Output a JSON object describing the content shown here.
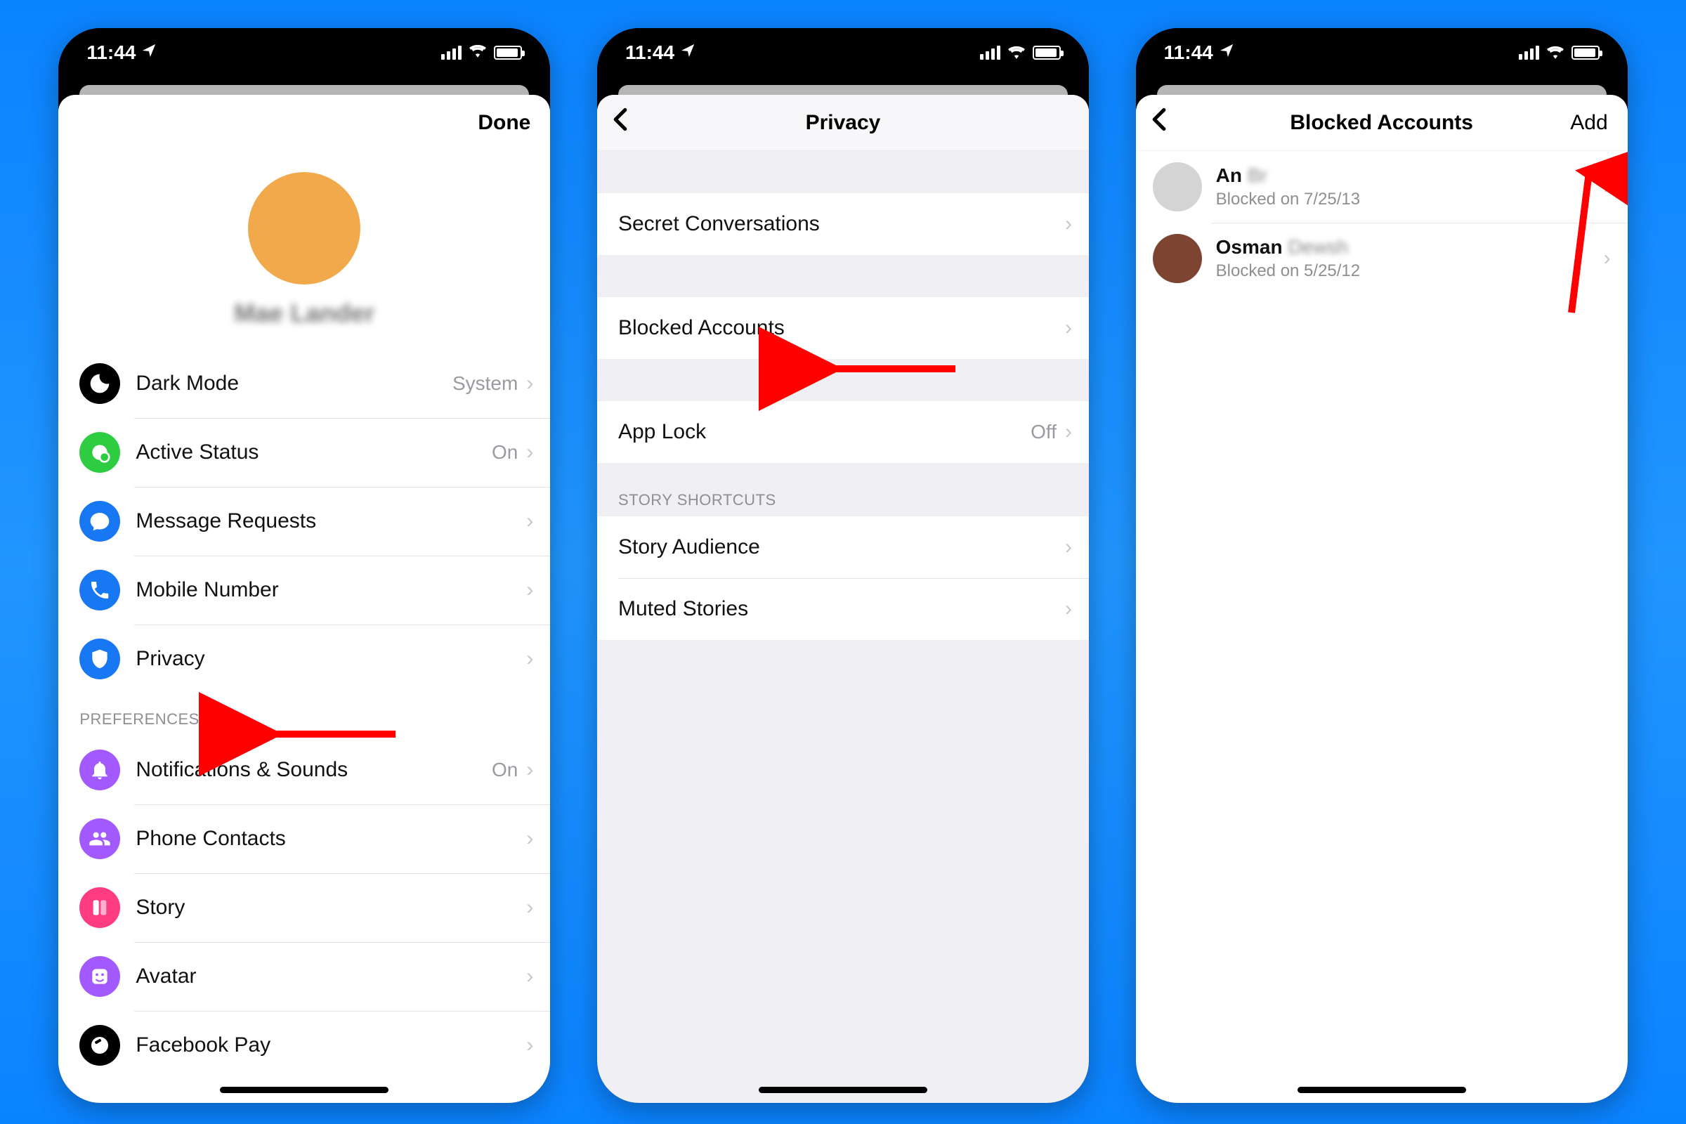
{
  "status": {
    "time": "11:44"
  },
  "screen1": {
    "done_label": "Done",
    "profile_name": "Mae Lander",
    "rows": [
      {
        "icon": "moon-icon",
        "icon_class": "ic-black",
        "label": "Dark Mode",
        "value": "System"
      },
      {
        "icon": "status-icon",
        "icon_class": "ic-green",
        "label": "Active Status",
        "value": "On"
      },
      {
        "icon": "message-icon",
        "icon_class": "ic-blue",
        "label": "Message Requests",
        "value": ""
      },
      {
        "icon": "phone-icon",
        "icon_class": "ic-blue",
        "label": "Mobile Number",
        "value": ""
      },
      {
        "icon": "shield-icon",
        "icon_class": "ic-blue",
        "label": "Privacy",
        "value": ""
      }
    ],
    "preferences_header": "PREFERENCES",
    "prefs": [
      {
        "icon": "bell-icon",
        "icon_class": "ic-purple",
        "label": "Notifications & Sounds",
        "value": "On"
      },
      {
        "icon": "contacts-icon",
        "icon_class": "ic-purple",
        "label": "Phone Contacts",
        "value": ""
      },
      {
        "icon": "story-icon",
        "icon_class": "ic-pink",
        "label": "Story",
        "value": ""
      },
      {
        "icon": "avatar-icon",
        "icon_class": "ic-purple",
        "label": "Avatar",
        "value": ""
      },
      {
        "icon": "pay-icon",
        "icon_class": "ic-black",
        "label": "Facebook Pay",
        "value": ""
      }
    ]
  },
  "screen2": {
    "title": "Privacy",
    "rows1": [
      {
        "label": "Secret Conversations",
        "value": ""
      }
    ],
    "rows2": [
      {
        "label": "Blocked Accounts",
        "value": ""
      }
    ],
    "rows3": [
      {
        "label": "App Lock",
        "value": "Off"
      }
    ],
    "story_header": "STORY SHORTCUTS",
    "story_rows": [
      {
        "label": "Story Audience",
        "value": ""
      },
      {
        "label": "Muted Stories",
        "value": ""
      }
    ]
  },
  "screen3": {
    "title": "Blocked Accounts",
    "add_label": "Add",
    "blocked": [
      {
        "avatar_color": "#d4d4d4",
        "name_visible": "An",
        "name_blur": "Br",
        "sub": "Blocked on 7/25/13"
      },
      {
        "avatar_color": "#7d4431",
        "name_visible": "Osman",
        "name_blur": "Dewsh",
        "sub": "Blocked on 5/25/12"
      }
    ]
  }
}
